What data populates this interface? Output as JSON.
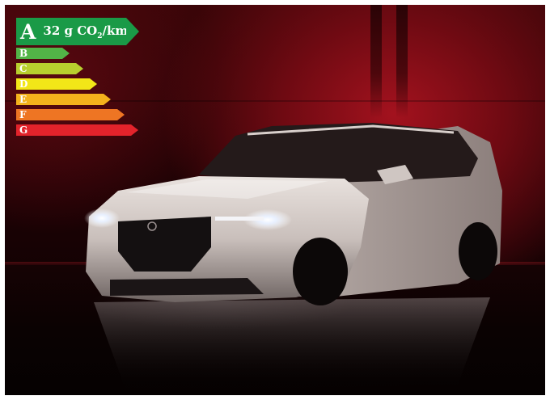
{
  "efficiency_label": {
    "current_class": "A",
    "emission_value": "32",
    "emission_unit_prefix": "g CO",
    "emission_unit_sub": "2",
    "emission_unit_suffix": "/km",
    "classes": [
      {
        "letter": "A",
        "color": "#1a9a47"
      },
      {
        "letter": "B",
        "color": "#52b447"
      },
      {
        "letter": "C",
        "color": "#b8cf2e"
      },
      {
        "letter": "D",
        "color": "#f2e618"
      },
      {
        "letter": "E",
        "color": "#f4b21c"
      },
      {
        "letter": "F",
        "color": "#ee7523"
      },
      {
        "letter": "G",
        "color": "#e3232b"
      }
    ]
  },
  "scene": {
    "background_color": "#a3121e",
    "subject": "car-photo"
  }
}
